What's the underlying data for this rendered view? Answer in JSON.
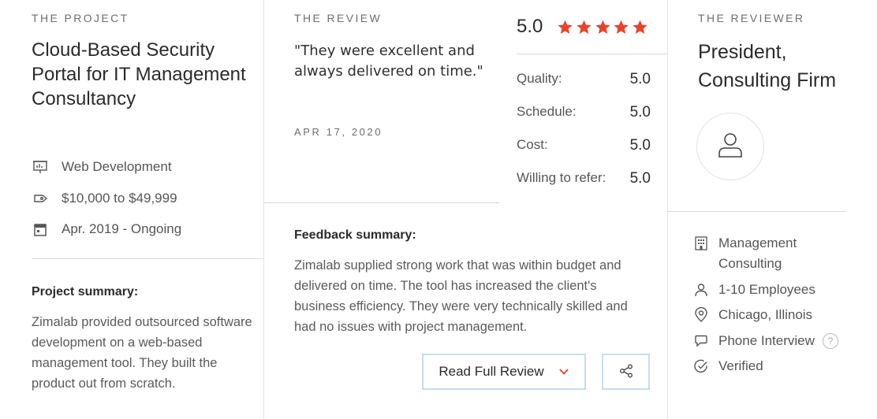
{
  "project": {
    "eyebrow": "THE PROJECT",
    "title": "Cloud-Based Security Portal for IT Management Consultancy",
    "service": "Web Development",
    "budget": "$10,000 to $49,999",
    "timeline": "Apr. 2019 - Ongoing",
    "summary_label": "Project summary:",
    "summary_text": "Zimalab provided outsourced software development on a web-based management tool. They built the product out from scratch."
  },
  "review": {
    "eyebrow": "THE REVIEW",
    "quote": "\"They were excellent and always delivered on time.\"",
    "date": "APR 17, 2020",
    "overall_score": "5.0",
    "star_count": 5,
    "star_color": "#e8442c",
    "ratings": [
      {
        "label": "Quality:",
        "value": "5.0"
      },
      {
        "label": "Schedule:",
        "value": "5.0"
      },
      {
        "label": "Cost:",
        "value": "5.0"
      },
      {
        "label": "Willing to refer:",
        "value": "5.0"
      }
    ],
    "feedback_label": "Feedback summary:",
    "feedback_text": "Zimalab supplied strong work that was within budget and delivered on time. The tool has increased the client's business efficiency. They were very technically skilled and had no issues with project management.",
    "read_full_label": "Read Full Review",
    "read_full_chevron_icon": "chevron-down-icon",
    "share_icon": "share-icon"
  },
  "reviewer": {
    "eyebrow": "THE REVIEWER",
    "title": "President, Consulting Firm",
    "avatar_icon": "user-icon",
    "industry": "Management Consulting",
    "size": "1-10 Employees",
    "location": "Chicago, Illinois",
    "interview_type": "Phone Interview",
    "help_mark": "?",
    "verified": "Verified"
  },
  "colors": {
    "accent_red": "#e8442c",
    "button_border": "#c9dde6",
    "divider": "#d8d8d8"
  }
}
